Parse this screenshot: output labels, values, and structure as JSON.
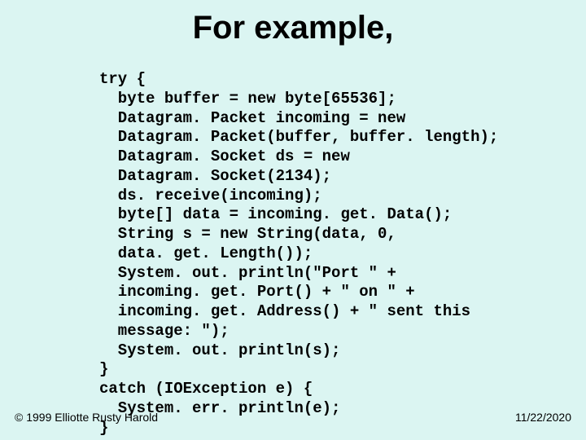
{
  "title": "For example,",
  "code": "try {\n  byte buffer = new byte[65536];\n  Datagram. Packet incoming = new\n  Datagram. Packet(buffer, buffer. length);\n  Datagram. Socket ds = new\n  Datagram. Socket(2134);\n  ds. receive(incoming);\n  byte[] data = incoming. get. Data();\n  String s = new String(data, 0,\n  data. get. Length());\n  System. out. println(\"Port \" +\n  incoming. get. Port() + \" on \" +\n  incoming. get. Address() + \" sent this\n  message: \");\n  System. out. println(s);\n}\ncatch (IOException e) {\n  System. err. println(e);\n}",
  "footer_left": "© 1999 Elliotte Rusty Harold",
  "footer_right": "11/22/2020"
}
